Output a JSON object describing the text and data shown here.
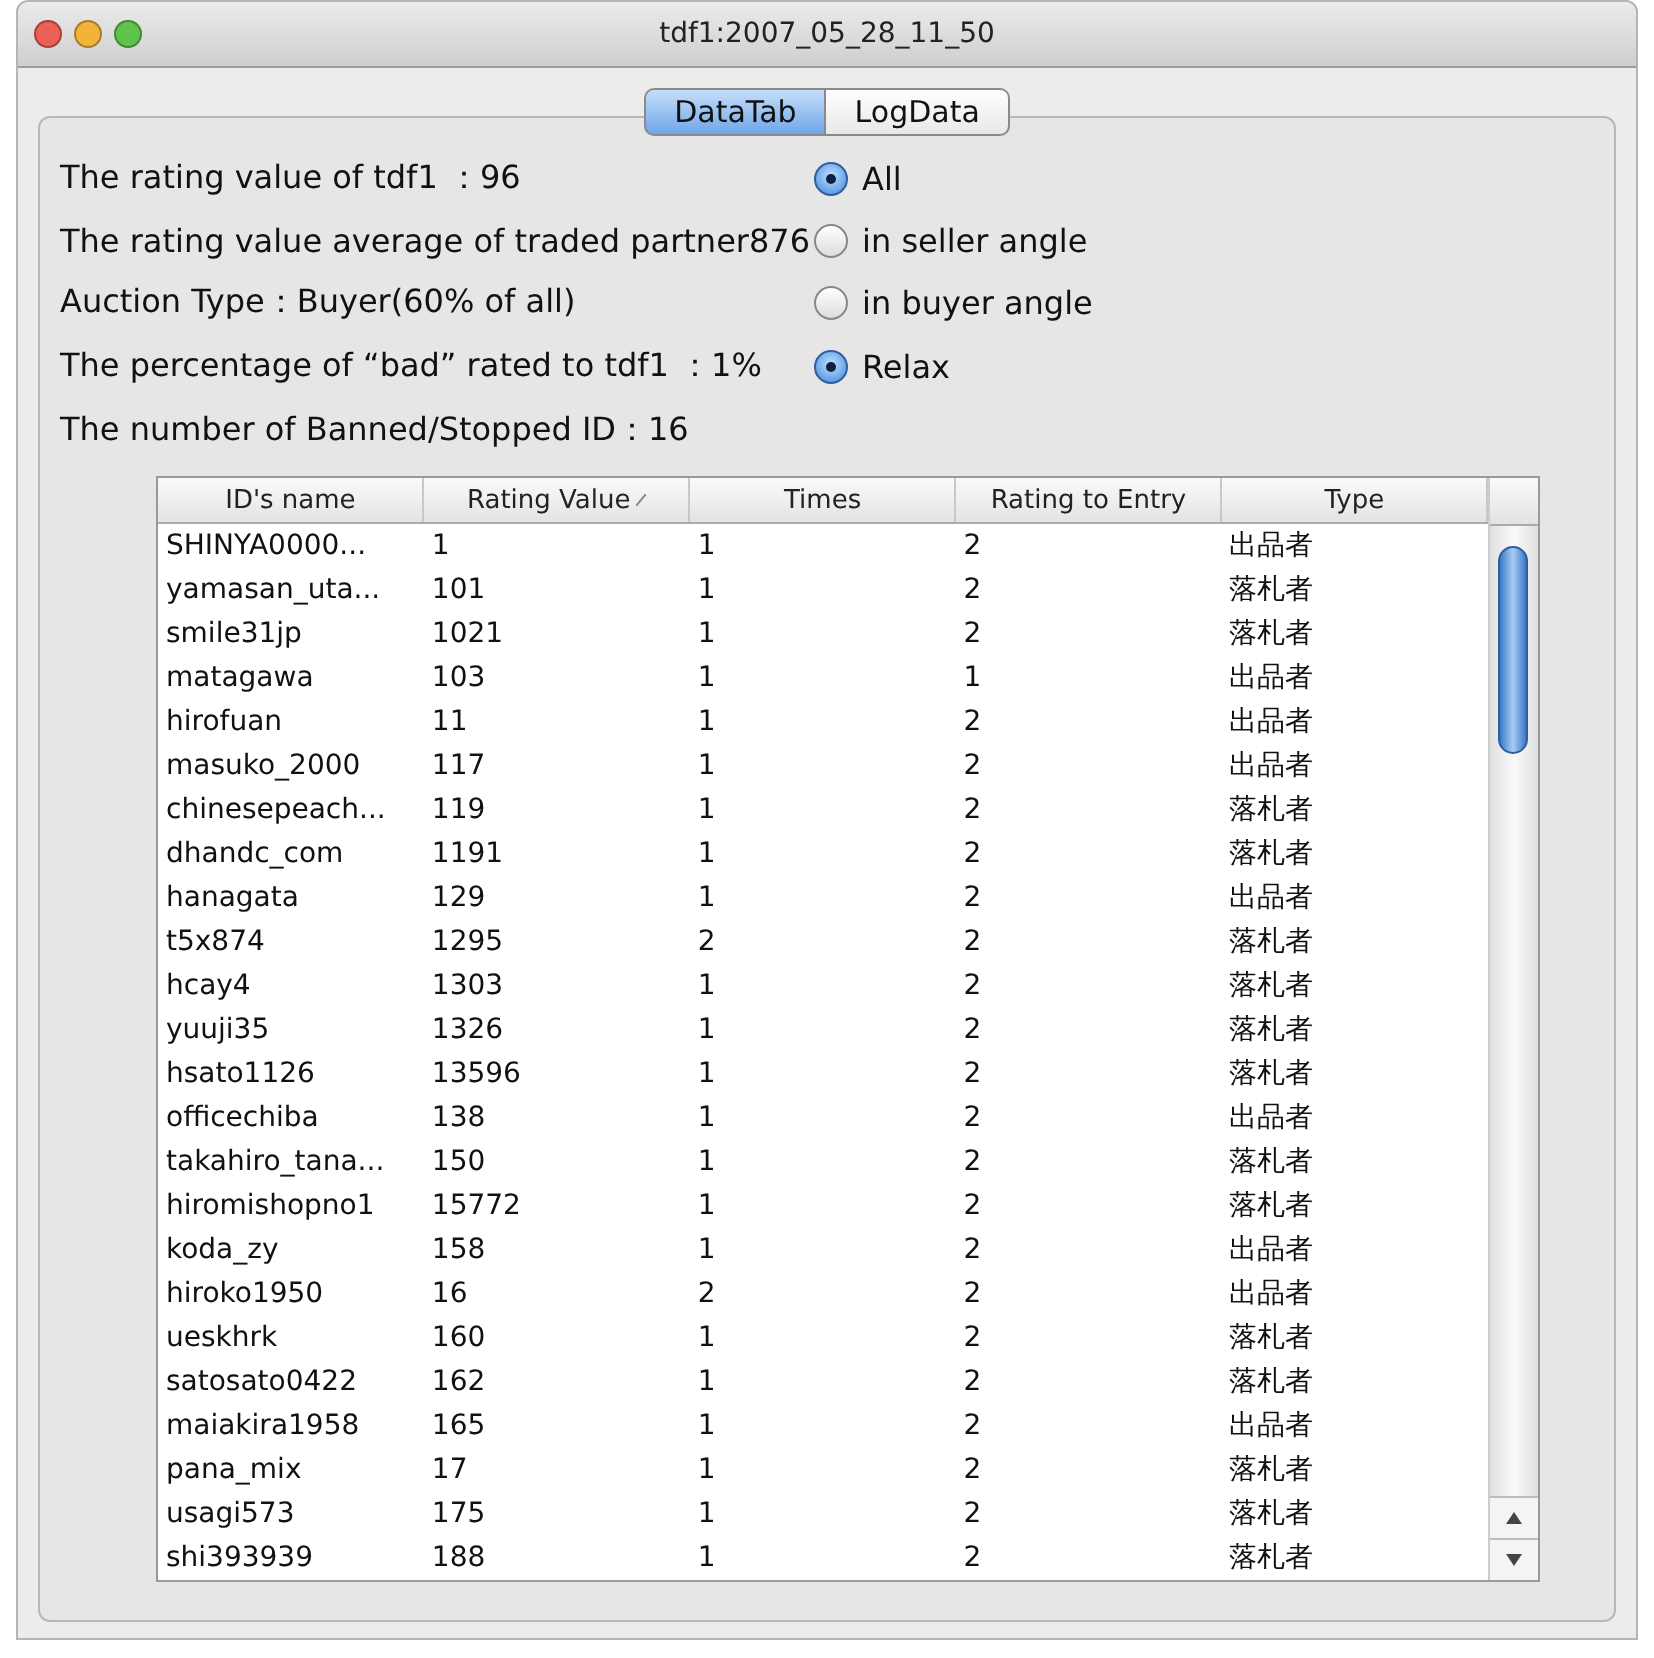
{
  "window": {
    "title": "tdf1:2007_05_28_11_50"
  },
  "tabs": [
    {
      "label": "DataTab",
      "selected": true
    },
    {
      "label": "LogData",
      "selected": false
    }
  ],
  "info_lines": [
    "The rating value of tdf1 ：96",
    "The rating value average of traded partner876",
    "Auction Type：Buyer(60% of all)",
    "The percentage of “bad” rated to tdf1 ：1%",
    "The number of Banned/Stopped ID：16"
  ],
  "options": [
    {
      "label": "All",
      "selected": true
    },
    {
      "label": "in seller angle",
      "selected": false
    },
    {
      "label": "in buyer angle",
      "selected": false
    },
    {
      "label": "Relax",
      "selected": true
    }
  ],
  "table": {
    "columns": [
      {
        "label": "ID's name",
        "sorted": false
      },
      {
        "label": "Rating Value",
        "sorted": true
      },
      {
        "label": "Times",
        "sorted": false
      },
      {
        "label": "Rating to Entry",
        "sorted": false
      },
      {
        "label": "Type",
        "sorted": false
      }
    ],
    "rows": [
      [
        "SHINYA0000...",
        "1",
        "1",
        "2",
        "出品者"
      ],
      [
        "yamasan_uta...",
        "101",
        "1",
        "2",
        "落札者"
      ],
      [
        "smile31jp",
        "1021",
        "1",
        "2",
        "落札者"
      ],
      [
        "matagawa",
        "103",
        "1",
        "1",
        "出品者"
      ],
      [
        "hirofuan",
        "11",
        "1",
        "2",
        "出品者"
      ],
      [
        "masuko_2000",
        "117",
        "1",
        "2",
        "出品者"
      ],
      [
        "chinesepeach...",
        "119",
        "1",
        "2",
        "落札者"
      ],
      [
        "dhandc_com",
        "1191",
        "1",
        "2",
        "落札者"
      ],
      [
        "hanagata",
        "129",
        "1",
        "2",
        "出品者"
      ],
      [
        "t5x874",
        "1295",
        "2",
        "2",
        "落札者"
      ],
      [
        "hcay4",
        "1303",
        "1",
        "2",
        "落札者"
      ],
      [
        "yuuji35",
        "1326",
        "1",
        "2",
        "落札者"
      ],
      [
        "hsato1126",
        "13596",
        "1",
        "2",
        "落札者"
      ],
      [
        "officechiba",
        "138",
        "1",
        "2",
        "出品者"
      ],
      [
        "takahiro_tana...",
        "150",
        "1",
        "2",
        "落札者"
      ],
      [
        "hiromishopno1",
        "15772",
        "1",
        "2",
        "落札者"
      ],
      [
        "koda_zy",
        "158",
        "1",
        "2",
        "出品者"
      ],
      [
        "hiroko1950",
        "16",
        "2",
        "2",
        "出品者"
      ],
      [
        "ueskhrk",
        "160",
        "1",
        "2",
        "落札者"
      ],
      [
        "satosato0422",
        "162",
        "1",
        "2",
        "落札者"
      ],
      [
        "maiakira1958",
        "165",
        "1",
        "2",
        "出品者"
      ],
      [
        "pana_mix",
        "17",
        "1",
        "2",
        "落札者"
      ],
      [
        "usagi573",
        "175",
        "1",
        "2",
        "落札者"
      ],
      [
        "shi393939",
        "188",
        "1",
        "2",
        "落札者"
      ]
    ]
  }
}
